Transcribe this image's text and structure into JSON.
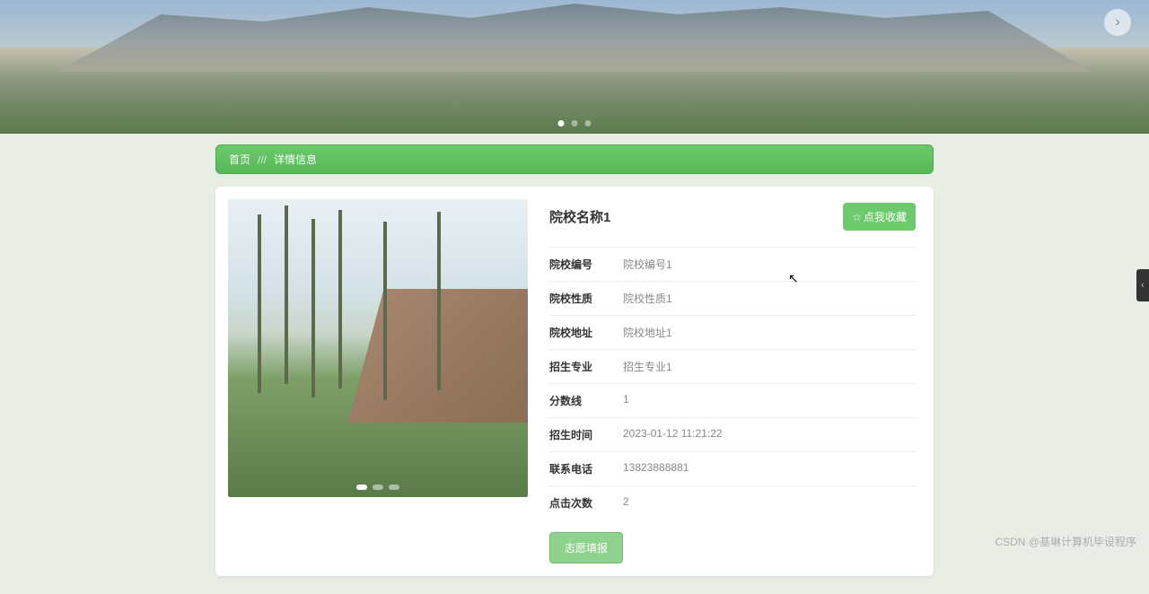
{
  "hero": {
    "dot_count": 3,
    "active_dot": 0
  },
  "breadcrumb": {
    "home": "首页",
    "separator": "///",
    "current": "详情信息"
  },
  "gallery": {
    "dot_count": 3,
    "active_dot": 0
  },
  "detail": {
    "title": "院校名称1",
    "favorite_label": "点我收藏",
    "fields": [
      {
        "label": "院校编号",
        "value": "院校编号1"
      },
      {
        "label": "院校性质",
        "value": "院校性质1"
      },
      {
        "label": "院校地址",
        "value": "院校地址1"
      },
      {
        "label": "招生专业",
        "value": "招生专业1"
      },
      {
        "label": "分数线",
        "value": "1"
      },
      {
        "label": "招生时间",
        "value": "2023-01-12 11:21:22"
      },
      {
        "label": "联系电话",
        "value": "13823888881"
      },
      {
        "label": "点击次数",
        "value": "2"
      }
    ],
    "apply_label": "志愿填报"
  },
  "watermark": "CSDN @基琳计算机毕设程序",
  "side_tab_glyph": "‹"
}
